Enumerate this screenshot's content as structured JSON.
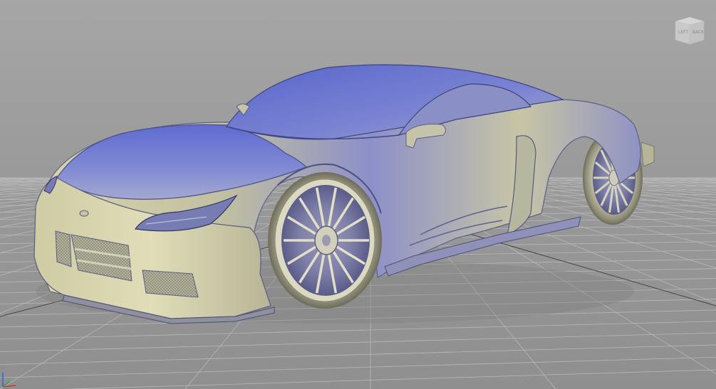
{
  "viewport": {
    "background_top": "#a3a3a3",
    "background_bottom": "#8e8e8e",
    "grid_color": "#b8b8b8"
  },
  "viewcube": {
    "left_label": "LEFT",
    "back_label": "BACK"
  },
  "axis_triad": {
    "x_color": "#cc3333",
    "y_color": "#2fa84f",
    "z_color": "#3366dd"
  },
  "model": {
    "icon": "supercar-3d-model",
    "body_color_light": "#d9d5b0",
    "body_color_blue": "#5563c8",
    "rim_color": "#c9c7b4"
  }
}
